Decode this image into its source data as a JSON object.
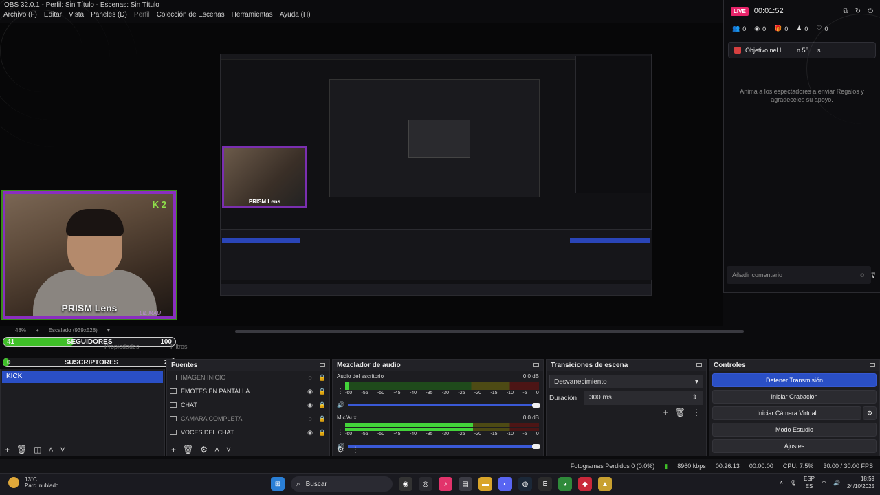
{
  "window": {
    "title": "OBS 32.0.1 - Perfil: Sin Título - Escenas: Sin Título"
  },
  "menu": [
    {
      "label": "Archivo (F)",
      "disabled": false
    },
    {
      "label": "Editar",
      "disabled": false
    },
    {
      "label": "Vista",
      "disabled": false
    },
    {
      "label": "Paneles (D)",
      "disabled": false
    },
    {
      "label": "Perfil",
      "disabled": true
    },
    {
      "label": "Colección de Escenas",
      "disabled": false
    },
    {
      "label": "Herramientas",
      "disabled": false
    },
    {
      "label": "Ayuda (H)",
      "disabled": false
    }
  ],
  "preview": {
    "cam_label": "PRISM Lens",
    "cam_badge": "K 2",
    "cam_watermark": "LIL MAU",
    "zoom": "48%",
    "scale": "Escalado (939x528)"
  },
  "overlays": {
    "followers": {
      "current": "41",
      "label": "SEGUIDORES",
      "goal": "100",
      "fill": 0.41
    },
    "subs": {
      "current": "0",
      "label": "SUSCRIPTORES",
      "goal": "20",
      "fill": 0.03
    },
    "behind_text": "Ninguna fuente seleccionada",
    "props_btn": "Propiedades",
    "filters_btn": "Filtros"
  },
  "docks": {
    "scenes": {
      "title": "Escenas",
      "items": [
        "KICK"
      ],
      "selected": 0
    },
    "sources": {
      "title": "Fuentes",
      "items": [
        {
          "name": "IMAGEN INICIO",
          "visible": false
        },
        {
          "name": "EMOTES EN PANTALLA",
          "visible": true
        },
        {
          "name": "CHAT",
          "visible": true
        },
        {
          "name": "CAMARA COMPLETA",
          "visible": false
        },
        {
          "name": "VOCES DEL CHAT",
          "visible": true
        }
      ]
    },
    "mixer": {
      "title": "Mezclador de audio",
      "channels": [
        {
          "name": "Audio del escritorio",
          "db": "0.0 dB",
          "level": 0.02,
          "peak": 0.27
        },
        {
          "name": "Mic/Aux",
          "db": "0.0 dB",
          "level": 0.66,
          "peak": 0.85
        }
      ],
      "ticks": [
        "-60",
        "-55",
        "-50",
        "-45",
        "-40",
        "-35",
        "-30",
        "-25",
        "-20",
        "-15",
        "-10",
        "-5",
        "0"
      ]
    },
    "transitions": {
      "title": "Transiciones de escena",
      "selected": "Desvanecimiento",
      "duration_label": "Duración",
      "duration_value": "300 ms"
    },
    "controls": {
      "title": "Controles",
      "buttons": [
        "Detener Transmisión",
        "Iniciar Grabación",
        "Iniciar Cámara Virtual",
        "Modo Estudio",
        "Ajustes"
      ]
    }
  },
  "status": {
    "dropped": "Fotogramas Perdidos 0 (0.0%)",
    "bitrate": "8960 kbps",
    "stream_time": "00:26:13",
    "rec_time": "00:00:00",
    "cpu": "CPU: 7.5%",
    "fps": "30.00 / 30.00 FPS"
  },
  "taskbar": {
    "temp": "13°C",
    "weather": "Parc. nublado",
    "search": "Buscar",
    "lang1": "ESP",
    "lang2": "ES",
    "time": "18:59",
    "date": "24/10/2025"
  },
  "chat": {
    "live": "LIVE",
    "timer": "00:01:52",
    "stats": [
      "0",
      "0",
      "0",
      "0",
      "0"
    ],
    "goal": "Objetivo nel L... ... n 58 ... s ...",
    "empty": "Anima a los espectadores a enviar Regalos y agradeceles su apoyo.",
    "input_placeholder": "Añadir comentario"
  },
  "colors": {
    "accent": "#2a4fc5",
    "live": "#e8246a",
    "meter_green": "#43d43a",
    "overlay_bar": "#3fbf28",
    "cam_border": "#8a2ec0"
  }
}
